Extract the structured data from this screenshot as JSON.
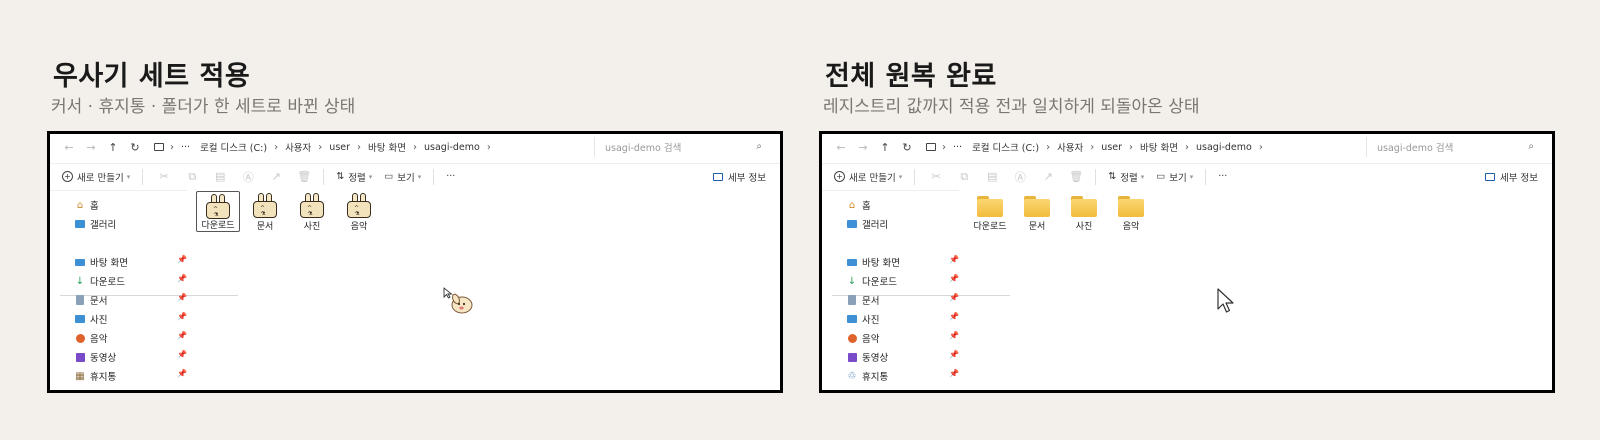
{
  "panels": [
    {
      "heading": "우사기 세트 적용",
      "subheading": "커서 · 휴지통 · 폴더가 한 세트로 바뀐 상태",
      "variant": "usagi"
    },
    {
      "heading": "전체 원복 완료",
      "subheading": "레지스트리 값까지 적용 전과 일치하게 되돌아온 상태",
      "variant": "default"
    }
  ],
  "explorer": {
    "nav": [
      "back-icon",
      "forward-icon",
      "up-icon",
      "refresh-icon"
    ],
    "breadcrumb": [
      "로컬 디스크 (C:)",
      "사용자",
      "user",
      "바탕 화면",
      "usagi-demo"
    ],
    "more": "···",
    "search_placeholder": "usagi-demo 검색",
    "toolbar": {
      "new": "새로 만들기",
      "sort": "정렬",
      "view": "보기",
      "more": "···",
      "details": "세부 정보"
    },
    "sidebar_top": [
      {
        "label": "홈",
        "icon": "home-icon"
      },
      {
        "label": "갤러리",
        "icon": "gallery-icon"
      }
    ],
    "sidebar_pinned": [
      {
        "label": "바탕 화면",
        "icon": "desktop-icon"
      },
      {
        "label": "다운로드",
        "icon": "download-icon"
      },
      {
        "label": "문서",
        "icon": "document-icon"
      },
      {
        "label": "사진",
        "icon": "pictures-icon"
      },
      {
        "label": "음악",
        "icon": "music-icon"
      },
      {
        "label": "동영상",
        "icon": "video-icon"
      },
      {
        "label": "휴지통",
        "icon": "recycle-bin-icon"
      }
    ],
    "folders": [
      "다운로드",
      "문서",
      "사진",
      "음악"
    ]
  },
  "colors": {
    "background": "#f3f0eb",
    "folder_yellow": "#f7c948",
    "bunny_cream": "#f3e3bd",
    "subtitle": "#7a7672"
  }
}
